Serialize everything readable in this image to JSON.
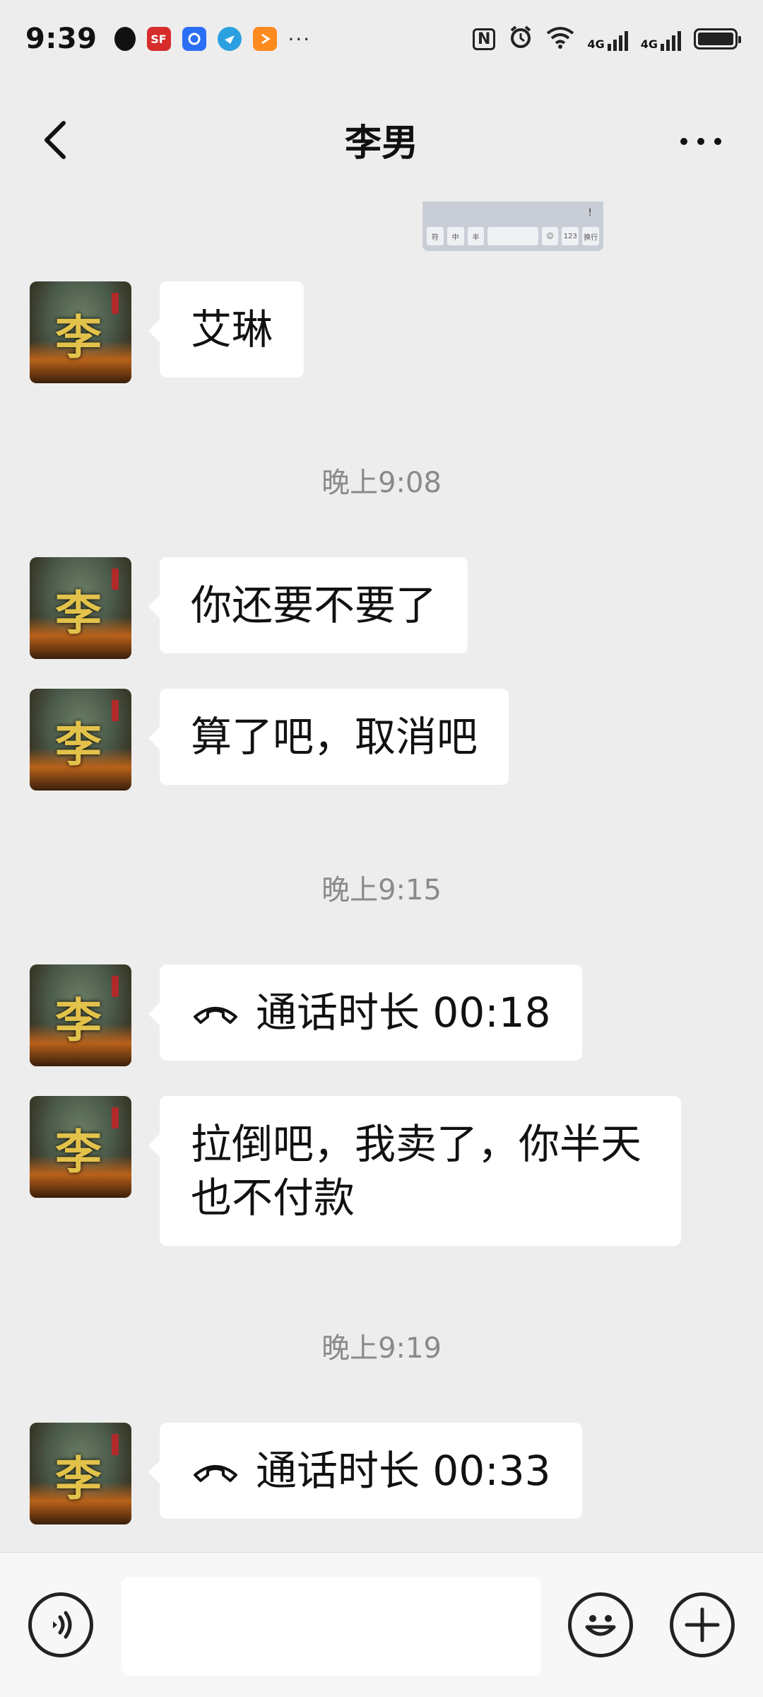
{
  "status_bar": {
    "time": "9:39",
    "app_icons": [
      "qq-icon",
      "sf-express-icon",
      "blue-app-icon",
      "globe-app-icon",
      "play-app-icon"
    ],
    "sf_label": "SF",
    "more": "···",
    "nfc": "N",
    "alarm_icon": "alarm-icon",
    "wifi_icon": "wifi-icon",
    "net1": "4G",
    "net2": "4G"
  },
  "header": {
    "title": "李男",
    "back_icon": "chevron-left-icon",
    "more_icon": "more-dots-icon"
  },
  "keyboard_preview": {
    "keys": [
      "符",
      "中",
      "半",
      "",
      "☺",
      "123",
      "换行"
    ],
    "top": "!"
  },
  "messages": [
    {
      "type": "text",
      "text": "艾琳"
    },
    {
      "type": "time",
      "text": "晚上9:08"
    },
    {
      "type": "text",
      "text": "你还要不要了"
    },
    {
      "type": "text",
      "text": "算了吧，取消吧"
    },
    {
      "type": "time",
      "text": "晚上9:15"
    },
    {
      "type": "call",
      "text": "通话时长 00:18"
    },
    {
      "type": "text",
      "line1": "拉倒吧，我卖了，你半天",
      "line2": "也不付款"
    },
    {
      "type": "time",
      "text": "晚上9:19"
    },
    {
      "type": "call",
      "text": "通话时长 00:33"
    }
  ],
  "avatar": {
    "glyph": "李",
    "description_icon": "avatar-image"
  },
  "input_bar": {
    "voice_icon": "voice-icon",
    "emoji_icon": "emoji-icon",
    "plus_icon": "plus-icon",
    "input_value": "",
    "input_placeholder": ""
  }
}
